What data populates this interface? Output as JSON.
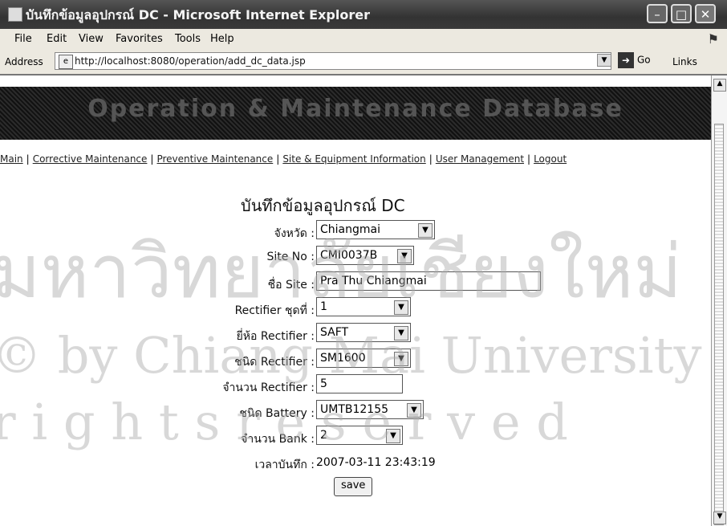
{
  "window": {
    "title": "บันทึกข้อมูลอุปกรณ์ DC - Microsoft Internet Explorer"
  },
  "menu": {
    "items": [
      "File",
      "Edit",
      "View",
      "Favorites",
      "Tools",
      "Help"
    ]
  },
  "address": {
    "label": "Address",
    "url": "http://localhost:8080/operation/add_dc_data.jsp",
    "go": "Go",
    "links": "Links"
  },
  "banner": {
    "title": "Operation & Maintenance Database"
  },
  "nav": {
    "items": [
      "Main",
      "Corrective Maintenance",
      "Preventive Maintenance",
      "Site & Equipment Information",
      "User Management",
      "Logout"
    ]
  },
  "form": {
    "title": "บันทึกข้อมูลอุปกรณ์ DC",
    "province_label": "จังหวัด :",
    "province_value": "Chiangmai",
    "site_no_label": "Site No :",
    "site_no_value": "CMI0037B",
    "site_name_label": "ชื่อ Site :",
    "site_name_value": "Pra Thu Chiangmai",
    "rectifier_set_label": "Rectifier ชุดที่ :",
    "rectifier_set_value": "1",
    "rectifier_brand_label": "ยี่ห้อ Rectifier :",
    "rectifier_brand_value": "SAFT",
    "rectifier_type_label": "ชนิด Rectifier :",
    "rectifier_type_value": "SM1600",
    "rectifier_count_label": "จำนวน Rectifier :",
    "rectifier_count_value": "5",
    "battery_type_label": "ชนิด Battery :",
    "battery_type_value": "UMTB12155",
    "bank_count_label": "จำนวน Bank :",
    "bank_count_value": "2",
    "record_time_label": "เวลาบันทึก :",
    "record_time_value": "2007-03-11 23:43:19",
    "save_label": "save"
  },
  "watermark": {
    "line1": "มหาวิทยาลัยเชียงใหม่",
    "line2": "© by Chiang Mai University",
    "line3": "r i g h t s r e s e r v e d"
  }
}
